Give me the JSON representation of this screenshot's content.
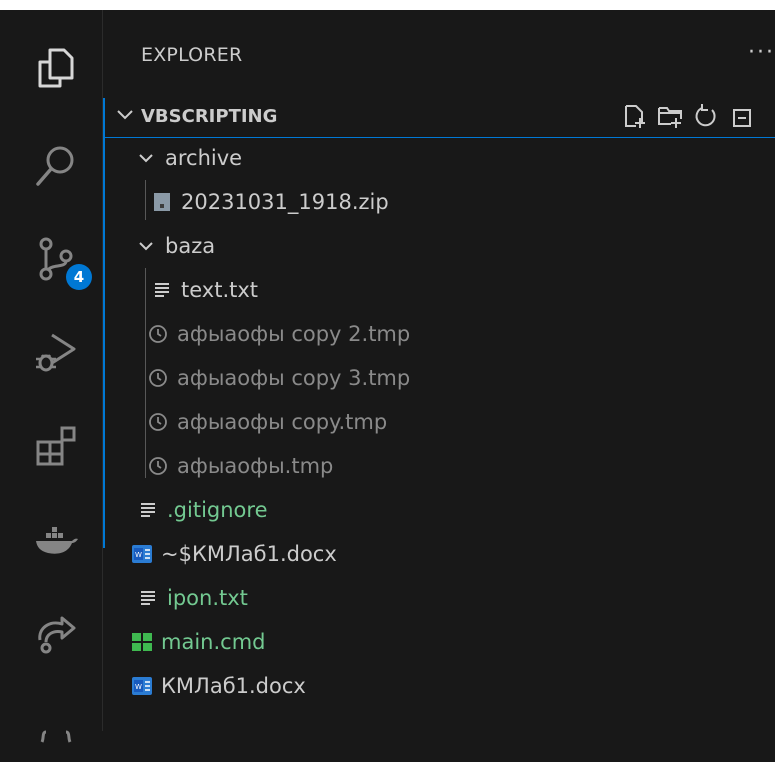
{
  "explorer": {
    "title": "EXPLORER",
    "more": "···"
  },
  "activity_bar": {
    "scm_badge": "4",
    "items": [
      {
        "icon": "files-icon"
      },
      {
        "icon": "search-icon"
      },
      {
        "icon": "source-control-icon"
      },
      {
        "icon": "run-debug-icon"
      },
      {
        "icon": "extensions-icon"
      },
      {
        "icon": "docker-icon"
      },
      {
        "icon": "remote-explorer-icon"
      },
      {
        "icon": "json-icon"
      }
    ]
  },
  "workspace": {
    "name": "VBSCRIPTING",
    "actions": [
      "new-file-icon",
      "new-folder-icon",
      "refresh-icon",
      "collapse-icon"
    ]
  },
  "tree": [
    {
      "label": "archive",
      "type": "folder",
      "indent": 0
    },
    {
      "label": "20231031_1918.zip",
      "type": "zip",
      "indent": 1
    },
    {
      "label": "baza",
      "type": "folder",
      "indent": 0
    },
    {
      "label": "text.txt",
      "type": "text",
      "indent": 1
    },
    {
      "label": "афыаофы copy 2.tmp",
      "type": "tmp",
      "indent": 1
    },
    {
      "label": "афыаофы copy 3.tmp",
      "type": "tmp",
      "indent": 1
    },
    {
      "label": "афыаофы copy.tmp",
      "type": "tmp",
      "indent": 1
    },
    {
      "label": "афыаофы.tmp",
      "type": "tmp",
      "indent": 1
    },
    {
      "label": ".gitignore",
      "type": "text",
      "indent": 0,
      "status": "U"
    },
    {
      "label": "~$КМЛаб1.docx",
      "type": "word",
      "indent": 0
    },
    {
      "label": "ipon.txt",
      "type": "text",
      "indent": 0,
      "status": "U"
    },
    {
      "label": "main.cmd",
      "type": "cmd",
      "indent": 0,
      "status": "U"
    },
    {
      "label": "КМЛаб1.docx",
      "type": "word",
      "indent": 0
    }
  ],
  "colors": {
    "background": "#181818",
    "accent": "#0078d4",
    "untracked": "#73c991",
    "text": "#cccccc",
    "dimmed": "#8a8a8a"
  }
}
